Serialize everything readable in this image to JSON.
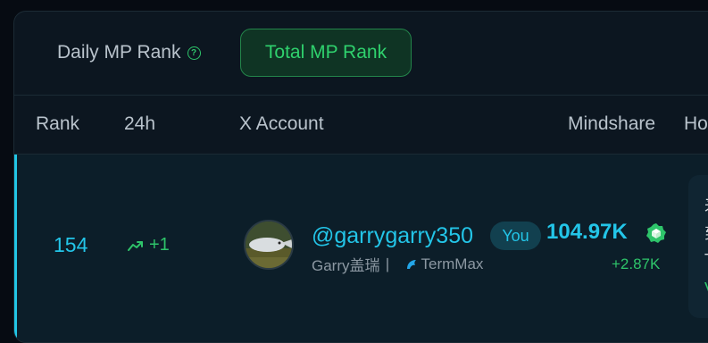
{
  "tabs": {
    "daily_label": "Daily MP Rank",
    "total_label": "Total MP Rank"
  },
  "columns": {
    "rank": "Rank",
    "change_24h": "24h",
    "account": "X Account",
    "mindshare": "Mindshare",
    "truncated_next": "Ho"
  },
  "row": {
    "rank": "154",
    "change": "+1",
    "handle": "@garrygarry350",
    "you_badge": "You",
    "display_name": "Garry盖瑞丨",
    "affiliation": "TermMax",
    "mindshare": "104.97K",
    "mindshare_delta": "+2.87K",
    "side_card_lines": [
      "来",
      "到",
      "T",
      "V"
    ]
  },
  "colors": {
    "accent_cyan": "#23c5e8",
    "accent_green": "#2ec46a"
  },
  "icons": [
    "help-icon",
    "trend-up-icon",
    "dolphin-icon",
    "verified-icon"
  ]
}
